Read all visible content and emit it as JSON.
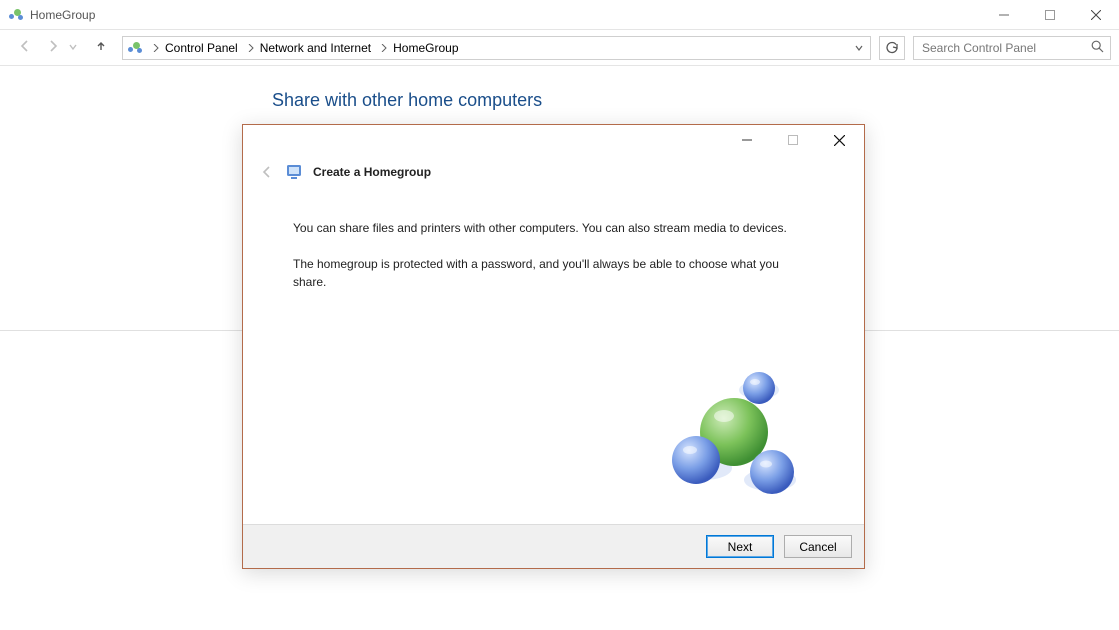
{
  "window": {
    "title": "HomeGroup"
  },
  "breadcrumb": {
    "items": [
      "Control Panel",
      "Network and Internet",
      "HomeGroup"
    ]
  },
  "search": {
    "placeholder": "Search Control Panel"
  },
  "page": {
    "heading": "Share with other home computers"
  },
  "wizard": {
    "title": "Create a Homegroup",
    "body1": "You can share files and printers with other computers. You can also stream media to devices.",
    "body2": "The homegroup is protected with a password, and you'll always be able to choose what you share.",
    "buttons": {
      "next": "Next",
      "cancel": "Cancel"
    }
  }
}
